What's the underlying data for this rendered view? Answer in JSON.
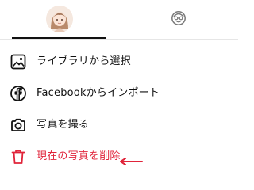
{
  "tabs": {
    "left": {
      "icon": "profile-avatar-icon"
    },
    "right": {
      "icon": "avatar-placeholder-icon"
    }
  },
  "menu": {
    "items": [
      {
        "label": "ライブラリから選択",
        "icon": "image-icon"
      },
      {
        "label": "Facebookからインポート",
        "icon": "facebook-icon"
      },
      {
        "label": "写真を撮る",
        "icon": "camera-icon"
      },
      {
        "label": "現在の写真を削除",
        "icon": "trash-icon"
      }
    ]
  },
  "colors": {
    "danger": "#e0243a",
    "text": "#111111",
    "tab_indicator": "#111111",
    "divider": "#e6e6e6"
  }
}
